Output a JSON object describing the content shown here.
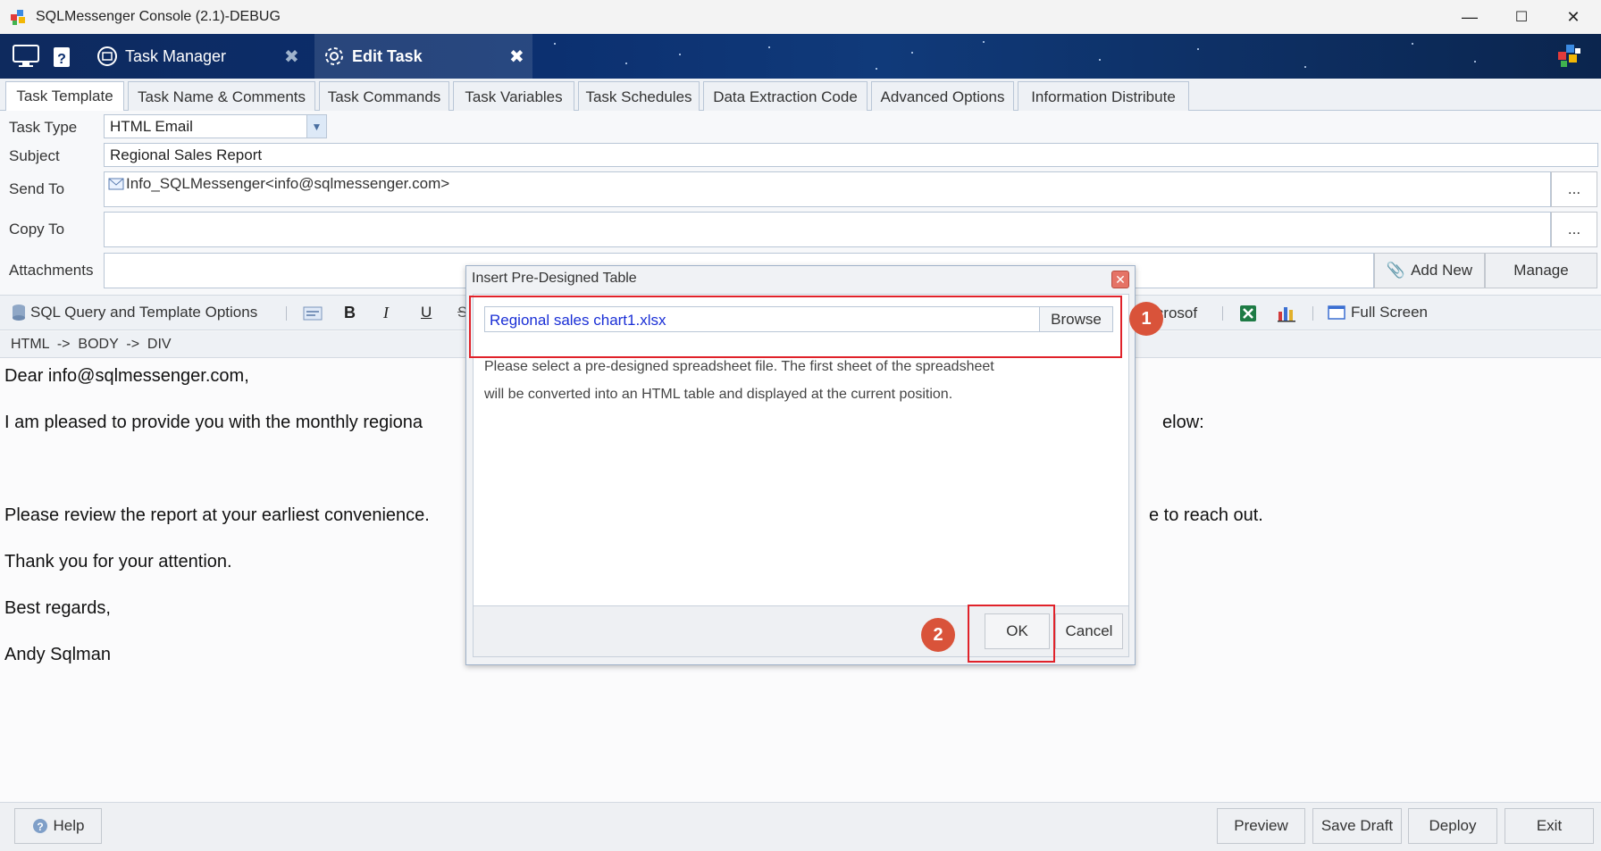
{
  "window": {
    "title": "SQLMessenger Console (2.1)-DEBUG",
    "min": "—",
    "max": "☐",
    "close": "✕"
  },
  "banner": {
    "tabs": [
      {
        "label": "Task Manager"
      },
      {
        "label": "Edit Task"
      }
    ]
  },
  "tabs": [
    "Task Template",
    "Task Name & Comments",
    "Task Commands",
    "Task Variables",
    "Task Schedules",
    "Data Extraction Code",
    "Advanced Options",
    "Information Distribute"
  ],
  "form": {
    "task_type_label": "Task Type",
    "task_type_value": "HTML Email",
    "subject_label": "Subject",
    "subject_value": "Regional Sales Report",
    "send_to_label": "Send To",
    "send_to_value": "Info_SQLMessenger<info@sqlmessenger.com>",
    "copy_to_label": "Copy To",
    "attachments_label": "Attachments",
    "ellipsis": "...",
    "add_new": "Add New",
    "manage": "Manage"
  },
  "toolbar": {
    "sql_options": "SQL Query and Template Options",
    "bold": "B",
    "italic": "I",
    "underline": "U",
    "microsoft": "icrosof",
    "full_screen": "Full Screen"
  },
  "breadcrumb": "HTML  ->  BODY  ->  DIV",
  "editor": {
    "greeting": "Dear info@sqlmessenger.com,",
    "line1_left": "I am pleased to provide you with the monthly regiona",
    "line1_right": "elow:",
    "line2_left": "Please review the report at your earliest convenience.",
    "line2_right": "e to reach out.",
    "thanks": "Thank you for your attention.",
    "regards": "Best regards,",
    "signature": "Andy Sqlman"
  },
  "dialog": {
    "title": "Insert Pre-Designed Table",
    "file_value": "Regional sales chart1.xlsx",
    "browse": "Browse",
    "desc_line1": "Please select a pre-designed spreadsheet file. The first sheet of the spreadsheet",
    "desc_line2": "will be converted into an HTML table and displayed at the current position.",
    "ok": "OK",
    "cancel": "Cancel",
    "badge1": "1",
    "badge2": "2"
  },
  "footer": {
    "help": "Help",
    "preview": "Preview",
    "save_draft": "Save Draft",
    "deploy": "Deploy",
    "exit": "Exit"
  },
  "colors": {
    "accent_red": "#e0222a",
    "badge": "#d9533a",
    "banner": "#0b2e6e",
    "link_blue": "#1a2fd6"
  }
}
